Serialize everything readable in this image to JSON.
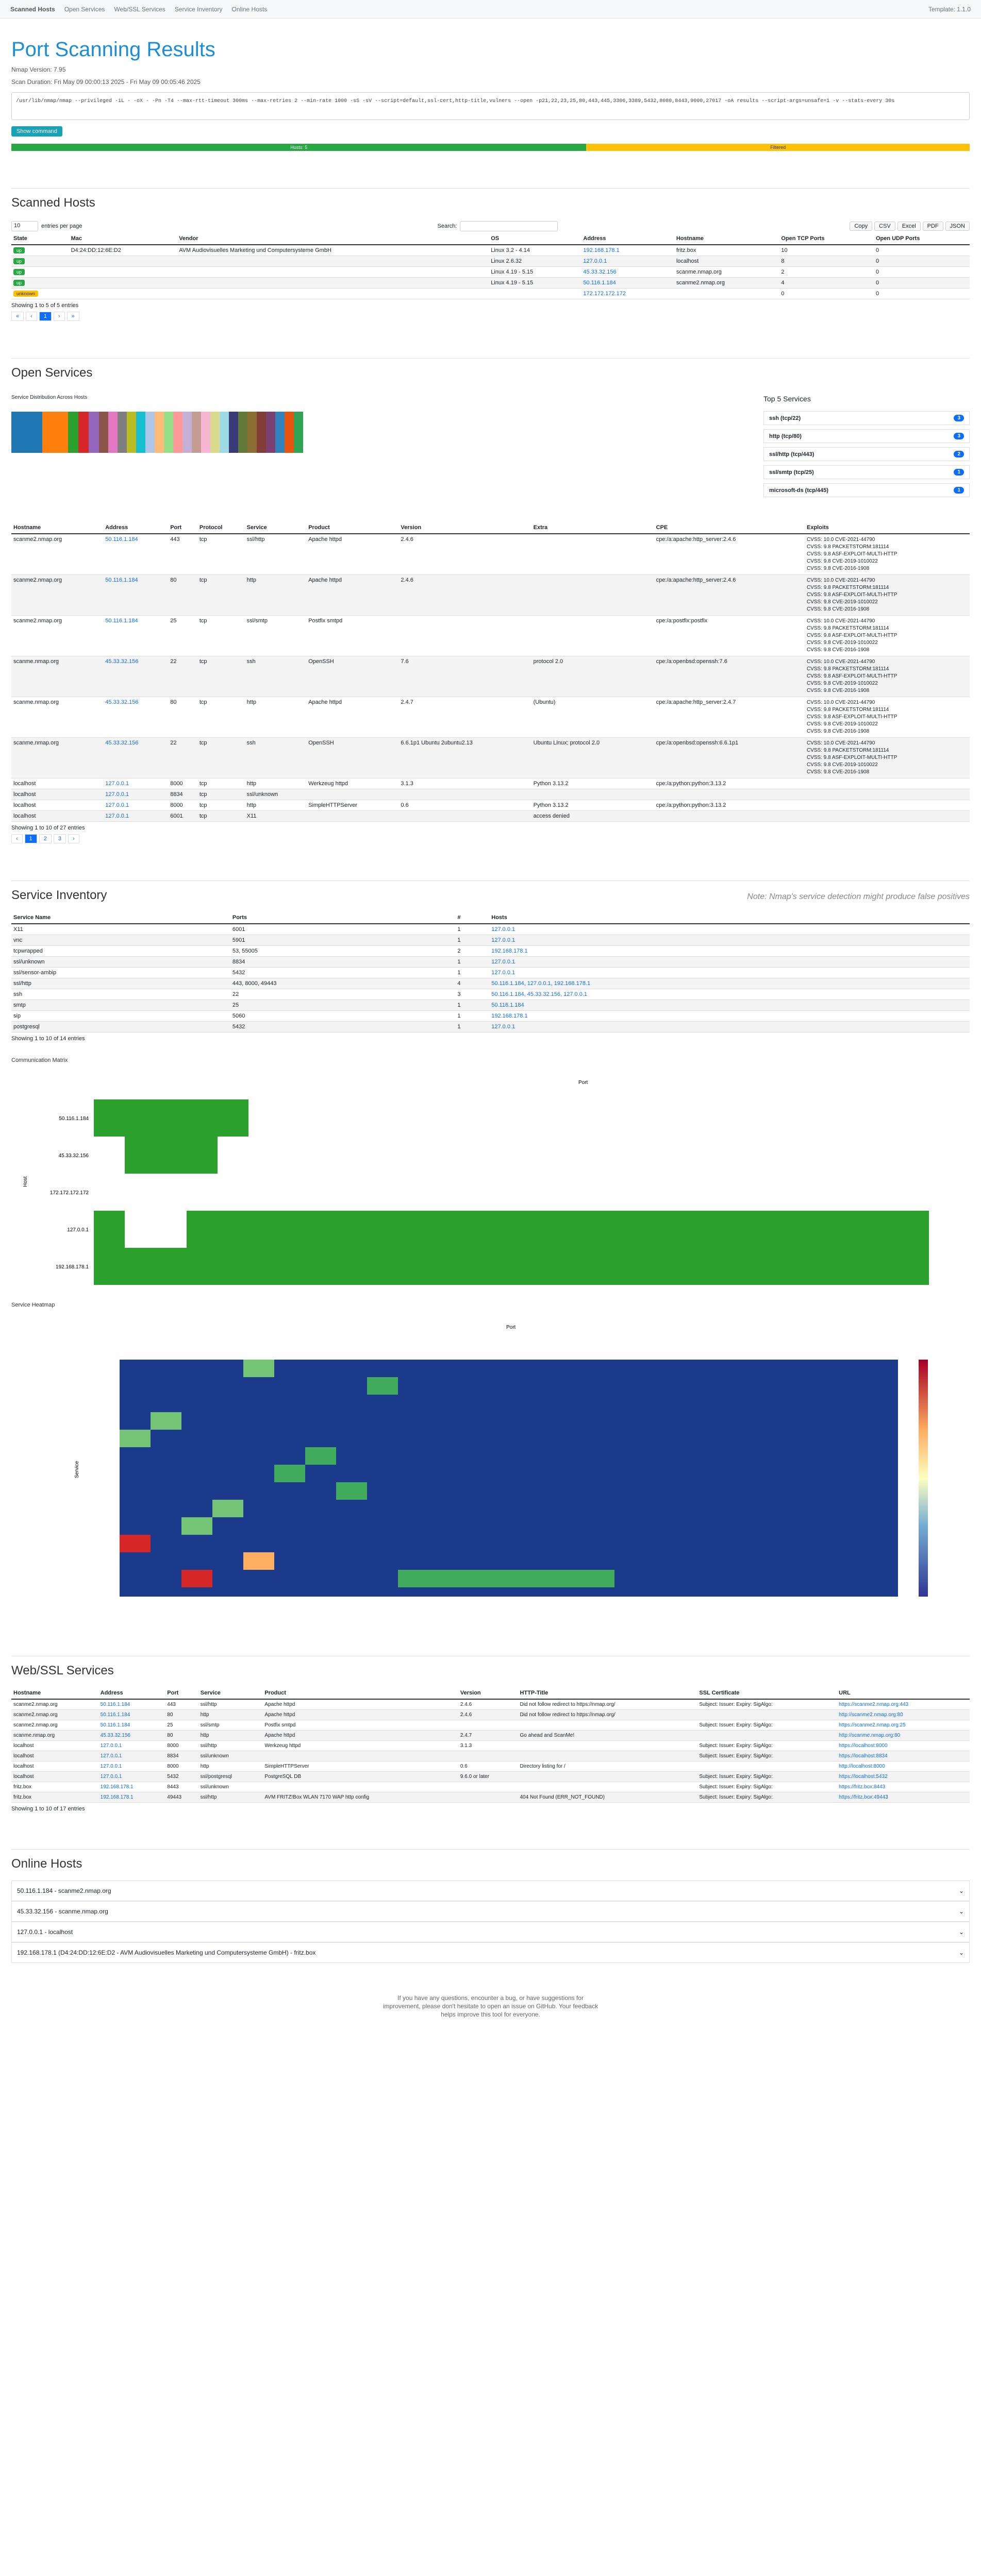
{
  "nav": {
    "brand": "Scanned Hosts",
    "items": [
      "Open Services",
      "Web/SSL Services",
      "Service Inventory",
      "Online Hosts"
    ],
    "right": "Template: 1.1.0"
  },
  "header": {
    "title": "Port Scanning Results",
    "version": "Nmap Version: 7.95",
    "duration": "Scan Duration: Fri May 09 00:00:13 2025 - Fri May 09 00:05:46 2025",
    "command": "/usr/lib/nmap/nmap --privileged -iL - -oX - -Pn -T4 --max-rtt-timeout 300ms --max-retries 2 --min-rate 1000 -sS -sV --script=default,ssl-cert,http-title,vulners --open -p21,22,23,25,80,443,445,3306,3389,5432,8080,8443,9000,27017 -oA results --script-args=unsafe=1 -v --stats-every 30s",
    "button": "Show command",
    "open_label": "Hosts: 5",
    "filtered_label": "Filtered"
  },
  "scanned": {
    "title": "Scanned Hosts",
    "per_page": "10",
    "entries": "entries per page",
    "search": "Search:",
    "buttons": [
      "Copy",
      "CSV",
      "Excel",
      "PDF",
      "JSON"
    ],
    "cols": [
      "State",
      "Mac",
      "Vendor",
      "OS",
      "Address",
      "Hostname",
      "Open TCP Ports",
      "Open UDP Ports"
    ],
    "rows": [
      [
        "up",
        "D4:24:DD:12:6E:D2",
        "AVM Audiovisuelles Marketing und Computersysteme GmbH",
        "Linux 3.2 - 4.14",
        "192.168.178.1",
        "fritz.box",
        "10",
        "0"
      ],
      [
        "up",
        "",
        "",
        "Linux 2.6.32",
        "127.0.0.1",
        "localhost",
        "8",
        "0"
      ],
      [
        "up",
        "",
        "",
        "Linux 4.19 - 5.15",
        "45.33.32.156",
        "scanme.nmap.org",
        "2",
        "0"
      ],
      [
        "up",
        "",
        "",
        "Linux 4.19 - 5.15",
        "50.116.1.184",
        "scanme2.nmap.org",
        "4",
        "0"
      ],
      [
        "unknown",
        "",
        "",
        "",
        "172.172.172.172",
        "",
        "0",
        "0"
      ]
    ],
    "info": "Showing 1 to 5 of 5 entries"
  },
  "services": {
    "title": "Open Services",
    "dist_label": "Service Distribution Across Hosts",
    "top5_title": "Top 5 Services",
    "top5": [
      [
        "ssh (tcp/22)",
        "3"
      ],
      [
        "http (tcp/80)",
        "3"
      ],
      [
        "ssl/http (tcp/443)",
        "2"
      ],
      [
        "ssl/smtp (tcp/25)",
        "1"
      ],
      [
        "microsoft-ds (tcp/445)",
        "1"
      ]
    ],
    "cols": [
      "Hostname",
      "Address",
      "Port",
      "Protocol",
      "Service",
      "Product",
      "Version",
      "Extra",
      "CPE",
      "Exploits"
    ],
    "rows": [
      [
        "scanme2.nmap.org",
        "50.116.1.184",
        "443",
        "tcp",
        "ssl/http",
        "Apache httpd",
        "2.4.6",
        "",
        "cpe:/a:apache:http_server:2.4.6"
      ],
      [
        "scanme2.nmap.org",
        "50.116.1.184",
        "80",
        "tcp",
        "http",
        "Apache httpd",
        "2.4.6",
        "",
        "cpe:/a:apache:http_server:2.4.6"
      ],
      [
        "scanme2.nmap.org",
        "50.116.1.184",
        "25",
        "tcp",
        "ssl/smtp",
        "Postfix smtpd",
        "",
        "",
        "cpe:/a:postfix:postfix"
      ],
      [
        "scanme.nmap.org",
        "45.33.32.156",
        "22",
        "tcp",
        "ssh",
        "OpenSSH",
        "7.6",
        "protocol 2.0",
        "cpe:/a:openbsd:openssh:7.6"
      ],
      [
        "scanme.nmap.org",
        "45.33.32.156",
        "80",
        "tcp",
        "http",
        "Apache httpd",
        "2.4.7",
        "(Ubuntu)",
        "cpe:/a:apache:http_server:2.4.7"
      ],
      [
        "scanme.nmap.org",
        "45.33.32.156",
        "22",
        "tcp",
        "ssh",
        "OpenSSH",
        "6.6.1p1 Ubuntu 2ubuntu2.13",
        "Ubuntu Linux; protocol 2.0",
        "cpe:/a:openbsd:openssh:6.6.1p1"
      ],
      [
        "localhost",
        "127.0.0.1",
        "8000",
        "tcp",
        "http",
        "Werkzeug httpd",
        "3.1.3",
        "Python 3.13.2",
        "cpe:/a:python:python:3.13.2"
      ],
      [
        "localhost",
        "127.0.0.1",
        "8834",
        "tcp",
        "ssl/unknown",
        "",
        "",
        "",
        ""
      ],
      [
        "localhost",
        "127.0.0.1",
        "8000",
        "tcp",
        "http",
        "SimpleHTTPServer",
        "0.6",
        "Python 3.13.2",
        "cpe:/a:python:python:3.13.2"
      ],
      [
        "localhost",
        "127.0.0.1",
        "6001",
        "tcp",
        "X11",
        "",
        "",
        "access denied",
        ""
      ]
    ],
    "exploits": [
      "CVSS: 10.0 CVE-2021-44790",
      "CVSS: 9.8 PACKETSTORM:181114",
      "CVSS: 9.8 ASF-EXPLOIT-MULTI-HTTP",
      "CVSS: 9.8 CVE-2019-1010022",
      "CVSS: 9.8 CVE-2016-1908"
    ],
    "info": "Showing 1 to 10 of 27 entries"
  },
  "inventory": {
    "title": "Service Inventory",
    "note": "Note: Nmap's service detection might produce false positives",
    "cols": [
      "Service Name",
      "Ports",
      "#",
      "Hosts"
    ],
    "rows": [
      [
        "X11",
        "6001",
        "1",
        "127.0.0.1"
      ],
      [
        "vnc",
        "5901",
        "1",
        "127.0.0.1"
      ],
      [
        "tcpwrapped",
        "53, 55005",
        "2",
        "192.168.178.1"
      ],
      [
        "ssl/unknown",
        "8834",
        "1",
        "127.0.0.1"
      ],
      [
        "ssl/sensor-ambip",
        "5432",
        "1",
        "127.0.0.1"
      ],
      [
        "ssl/http",
        "443, 8000, 49443",
        "4",
        "50.116.1.184, 127.0.0.1, 192.168.178.1"
      ],
      [
        "ssh",
        "22",
        "3",
        "50.116.1.184, 45.33.32.156, 127.0.0.1"
      ],
      [
        "smtp",
        "25",
        "1",
        "50.116.1.184"
      ],
      [
        "sip",
        "5060",
        "1",
        "192.168.178.1"
      ],
      [
        "postgresql",
        "5432",
        "1",
        "127.0.0.1"
      ]
    ],
    "info": "Showing 1 to 10 of 14 entries"
  },
  "matrix": {
    "title": "Communication Matrix",
    "xlabel": "Port",
    "ylabel": "Host",
    "hosts": [
      "50.116.1.184",
      "45.33.32.156",
      "172.172.172.172",
      "127.0.0.1",
      "192.168.178.1"
    ]
  },
  "heatmap": {
    "title": "Service Heatmap",
    "xlabel": "Port",
    "ylabel": "Service"
  },
  "web": {
    "title": "Web/SSL Services",
    "cols": [
      "Hostname",
      "Address",
      "Port",
      "Service",
      "Product",
      "Version",
      "HTTP-Title",
      "SSL Certificate",
      "URL"
    ],
    "rows": [
      [
        "scanme2.nmap.org",
        "50.116.1.184",
        "443",
        "ssl/http",
        "Apache httpd",
        "2.4.6",
        "Did not follow redirect to https://nmap.org/",
        "Subject: Issuer: Expiry: SigAlgo:",
        "https://scanme2.nmap.org:443"
      ],
      [
        "scanme2.nmap.org",
        "50.116.1.184",
        "80",
        "http",
        "Apache httpd",
        "2.4.6",
        "Did not follow redirect to https://nmap.org/",
        "",
        "http://scanme2.nmap.org:80"
      ],
      [
        "scanme2.nmap.org",
        "50.116.1.184",
        "25",
        "ssl/smtp",
        "Postfix smtpd",
        "",
        "",
        "Subject: Issuer: Expiry: SigAlgo:",
        "https://scanme2.nmap.org:25"
      ],
      [
        "scanme.nmap.org",
        "45.33.32.156",
        "80",
        "http",
        "Apache httpd",
        "2.4.7",
        "Go ahead and ScanMe!",
        "",
        "http://scanme.nmap.org:80"
      ],
      [
        "localhost",
        "127.0.0.1",
        "8000",
        "ssl/http",
        "Werkzeug httpd",
        "3.1.3",
        "",
        "Subject: Issuer: Expiry: SigAlgo:",
        "https://localhost:8000"
      ],
      [
        "localhost",
        "127.0.0.1",
        "8834",
        "ssl/unknown",
        "",
        "",
        "",
        "Subject: Issuer: Expiry: SigAlgo:",
        "https://localhost:8834"
      ],
      [
        "localhost",
        "127.0.0.1",
        "8000",
        "http",
        "SimpleHTTPServer",
        "0.6",
        "Directory listing for /",
        "",
        "http://localhost:8000"
      ],
      [
        "localhost",
        "127.0.0.1",
        "5432",
        "ssl/postgresql",
        "PostgreSQL DB",
        "9.6.0 or later",
        "",
        "Subject: Issuer: Expiry: SigAlgo:",
        "https://localhost:5432"
      ],
      [
        "fritz.box",
        "192.168.178.1",
        "8443",
        "ssl/unknown",
        "",
        "",
        "",
        "Subject: Issuer: Expiry: SigAlgo:",
        "https://fritz.box:8443"
      ],
      [
        "fritz.box",
        "192.168.178.1",
        "49443",
        "ssl/http",
        "AVM FRITZ!Box WLAN 7170 WAP http config",
        "",
        "404 Not Found (ERR_NOT_FOUND)",
        "Subject: Issuer: Expiry: SigAlgo:",
        "https://fritz.box:49443"
      ]
    ],
    "info": "Showing 1 to 10 of 17 entries"
  },
  "online": {
    "title": "Online Hosts",
    "items": [
      "50.116.1.184 - scanme2.nmap.org",
      "45.33.32.156 - scanme.nmap.org",
      "127.0.0.1 - localhost",
      "192.168.178.1 (D4:24:DD:12:6E:D2 - AVM Audiovisuelles Marketing und Computersysteme GmbH) - fritz.box"
    ]
  },
  "footer": "If you have any questions, encounter a bug, or have suggestions for improvement, please don't hesitate to open an issue on GitHub. Your feedback helps improve this tool for everyone.",
  "colors": {
    "accent": "#1a8fd8",
    "open": "#28a745",
    "filtered": "#ffc107",
    "matrix": "#2ca02c"
  }
}
